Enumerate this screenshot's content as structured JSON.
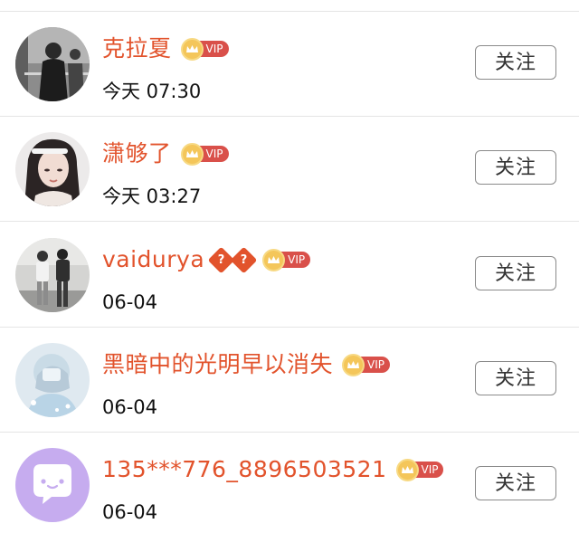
{
  "accent_color": "#e2532c",
  "follow_label": "关注",
  "rows": [
    {
      "name": "克拉夏",
      "time": "今天 07:30",
      "vip": "VIP",
      "emoji": []
    },
    {
      "name": "潇够了",
      "time": "今天 03:27",
      "vip": "VIP",
      "emoji": []
    },
    {
      "name": "vaidurya",
      "time": "06-04",
      "vip": "VIP",
      "emoji": [
        "?",
        "?"
      ]
    },
    {
      "name": "黑暗中的光明早以消失",
      "time": "06-04",
      "vip": "VIP",
      "emoji": []
    },
    {
      "name": "135***776_8896503521",
      "time": "06-04",
      "vip": "VIP",
      "emoji": []
    }
  ]
}
